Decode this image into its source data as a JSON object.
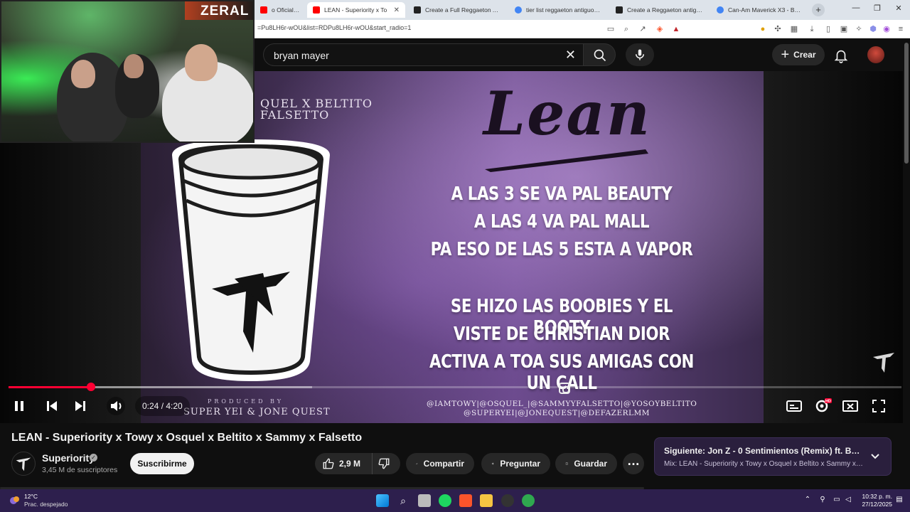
{
  "browser": {
    "tabs": [
      {
        "label": "o Oficial) - Reyk",
        "active": false,
        "favicon_color": "#ff0000"
      },
      {
        "label": "LEAN - Superiority x To",
        "active": true,
        "favicon_color": "#ff0000"
      },
      {
        "label": "Create a Full Reggaeton Antig",
        "active": false,
        "favicon_color": "#222222"
      },
      {
        "label": "tier list reggaeton antiguo - B",
        "active": false,
        "favicon_color": "#4285f4"
      },
      {
        "label": "Create a Reggaeton antiguo (E",
        "active": false,
        "favicon_color": "#222222"
      },
      {
        "label": "Can-Am Maverick X3 - Buscar",
        "active": false,
        "favicon_color": "#4285f4"
      }
    ],
    "url": "=Pu8LH6r-wOU&list=RDPu8LH6r-wOU&start_radio=1"
  },
  "header": {
    "search_query": "bryan mayer",
    "create_label": "Crear"
  },
  "webcam": {
    "name": "ZERAL"
  },
  "video": {
    "credit_line1": "QUEL X BELTITO",
    "credit_line2": "FALSETTO",
    "song_title": "Lean",
    "lyrics": [
      "A LAS 3 SE VA PAL BEAUTY",
      "A LAS 4 VA PAL MALL",
      "PA ESO DE LAS 5 ESTA A VAPOR",
      "SE HIZO LAS BOOBIES Y EL BOOTY",
      "VISTE DE CHRISTIAN DIOR",
      "ACTIVA A TOA SUS AMIGAS CON UN CALL"
    ],
    "produced_by": "PRODUCED BY",
    "producers": "SUPER YEI & JONE QUEST",
    "handles_line1": "@IAMTOWY|@OSQUEL_|@SAMMYYFALSETTO|@YOSOYBELTITO",
    "handles_line2": "@SUPERYEI|@JONEQUEST|@DEFAZERLMM"
  },
  "player": {
    "current_time": "0:24",
    "duration": "4:20",
    "time_display": "0:24 / 4:20",
    "progress_fraction": 0.092,
    "buffered_fraction": 0.34,
    "quality_badge": "HD"
  },
  "info": {
    "title": "LEAN - Superiority x Towy x Osquel x Beltito x Sammy x Falsetto",
    "channel": "Superiority",
    "subscribers": "3,45 M de suscriptores",
    "subscribe_label": "Suscribirme",
    "likes": "2,9 M",
    "share_label": "Compartir",
    "ask_label": "Preguntar",
    "save_label": "Guardar"
  },
  "next_up": {
    "title": "Siguiente: Jon Z - 0 Sentimientos (Remix) ft. Baby R...",
    "subtitle": "Mix: LEAN - Superiority x Towy x Osquel x Beltito x Sammy x ..."
  },
  "taskbar": {
    "temperature": "12°C",
    "weather": "Prac. despejado",
    "time": "10:32 p. m.",
    "date": "27/12/2025"
  },
  "colors": {
    "accent_red": "#ff0033",
    "taskbar": "#2d1f4d",
    "yt_bg": "#0f0f0f"
  }
}
